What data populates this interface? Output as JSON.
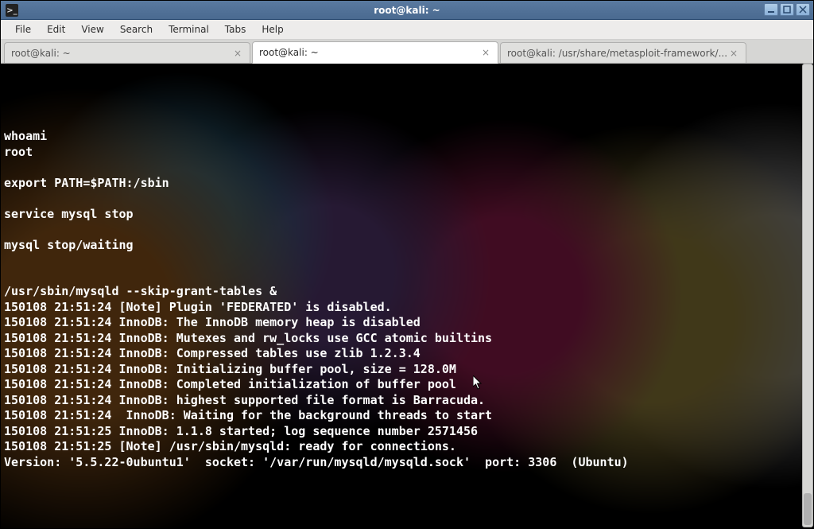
{
  "window": {
    "title": "root@kali: ~"
  },
  "menubar": {
    "items": [
      "File",
      "Edit",
      "View",
      "Search",
      "Terminal",
      "Tabs",
      "Help"
    ]
  },
  "tabs": [
    {
      "label": "root@kali: ~",
      "active": false
    },
    {
      "label": "root@kali: ~",
      "active": true
    },
    {
      "label": "root@kali: /usr/share/metasploit-framework/...",
      "active": false
    }
  ],
  "terminal": {
    "lines": [
      "",
      "",
      "",
      "",
      "whoami",
      "root",
      "",
      "export PATH=$PATH:/sbin",
      "",
      "service mysql stop",
      "",
      "mysql stop/waiting",
      "",
      "",
      "/usr/sbin/mysqld --skip-grant-tables &",
      "150108 21:51:24 [Note] Plugin 'FEDERATED' is disabled.",
      "150108 21:51:24 InnoDB: The InnoDB memory heap is disabled",
      "150108 21:51:24 InnoDB: Mutexes and rw_locks use GCC atomic builtins",
      "150108 21:51:24 InnoDB: Compressed tables use zlib 1.2.3.4",
      "150108 21:51:24 InnoDB: Initializing buffer pool, size = 128.0M",
      "150108 21:51:24 InnoDB: Completed initialization of buffer pool",
      "150108 21:51:24 InnoDB: highest supported file format is Barracuda.",
      "150108 21:51:24  InnoDB: Waiting for the background threads to start",
      "150108 21:51:25 InnoDB: 1.1.8 started; log sequence number 2571456",
      "150108 21:51:25 [Note] /usr/sbin/mysqld: ready for connections.",
      "Version: '5.5.22-0ubuntu1'  socket: '/var/run/mysqld/mysqld.sock'  port: 3306  (Ubuntu)"
    ]
  }
}
